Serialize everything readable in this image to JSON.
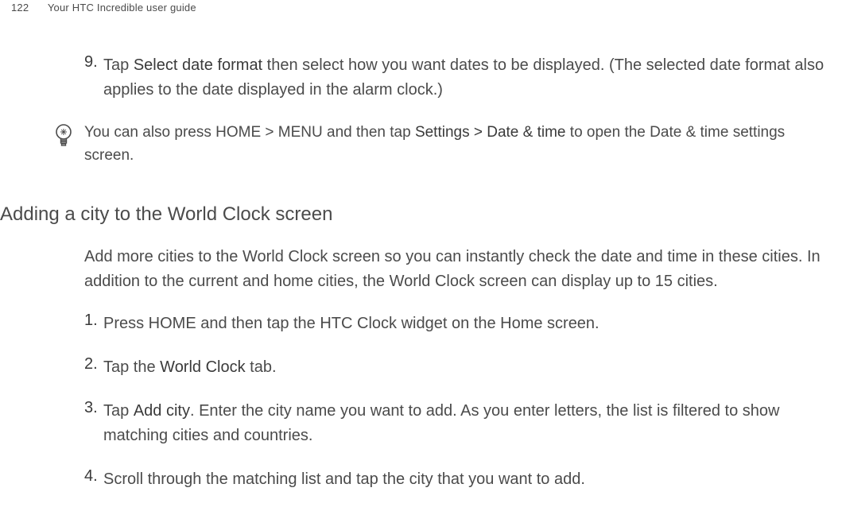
{
  "header": {
    "page_number": "122",
    "doc_title": "Your HTC Incredible user guide"
  },
  "step9": {
    "num": "9.",
    "pre": "Tap ",
    "bold": "Select date format",
    "post": " then select how you want dates to be displayed. (The selected date format also applies to the date displayed in the alarm clock.)"
  },
  "tip": {
    "pre": "You can also press HOME > MENU and then tap ",
    "bold": "Settings > Date & time",
    "post": " to open the Date & time settings screen."
  },
  "section_heading": "Adding a city to the World Clock screen",
  "intro": "Add more cities to the World Clock screen so you can instantly check the date and time in these cities. In addition to the current and home cities, the World Clock screen can display up to 15 cities.",
  "steps": {
    "s1": {
      "num": "1.",
      "text": "Press HOME and then tap the HTC Clock widget on the Home screen."
    },
    "s2": {
      "num": "2.",
      "pre": "Tap the ",
      "bold": "World Clock",
      "post": " tab."
    },
    "s3": {
      "num": "3.",
      "pre": "Tap ",
      "bold": "Add city",
      "post": ". Enter the city name you want to add. As you enter letters, the list is filtered to show matching cities and countries."
    },
    "s4": {
      "num": "4.",
      "text": "Scroll through the matching list and tap the city that you want to add."
    }
  }
}
